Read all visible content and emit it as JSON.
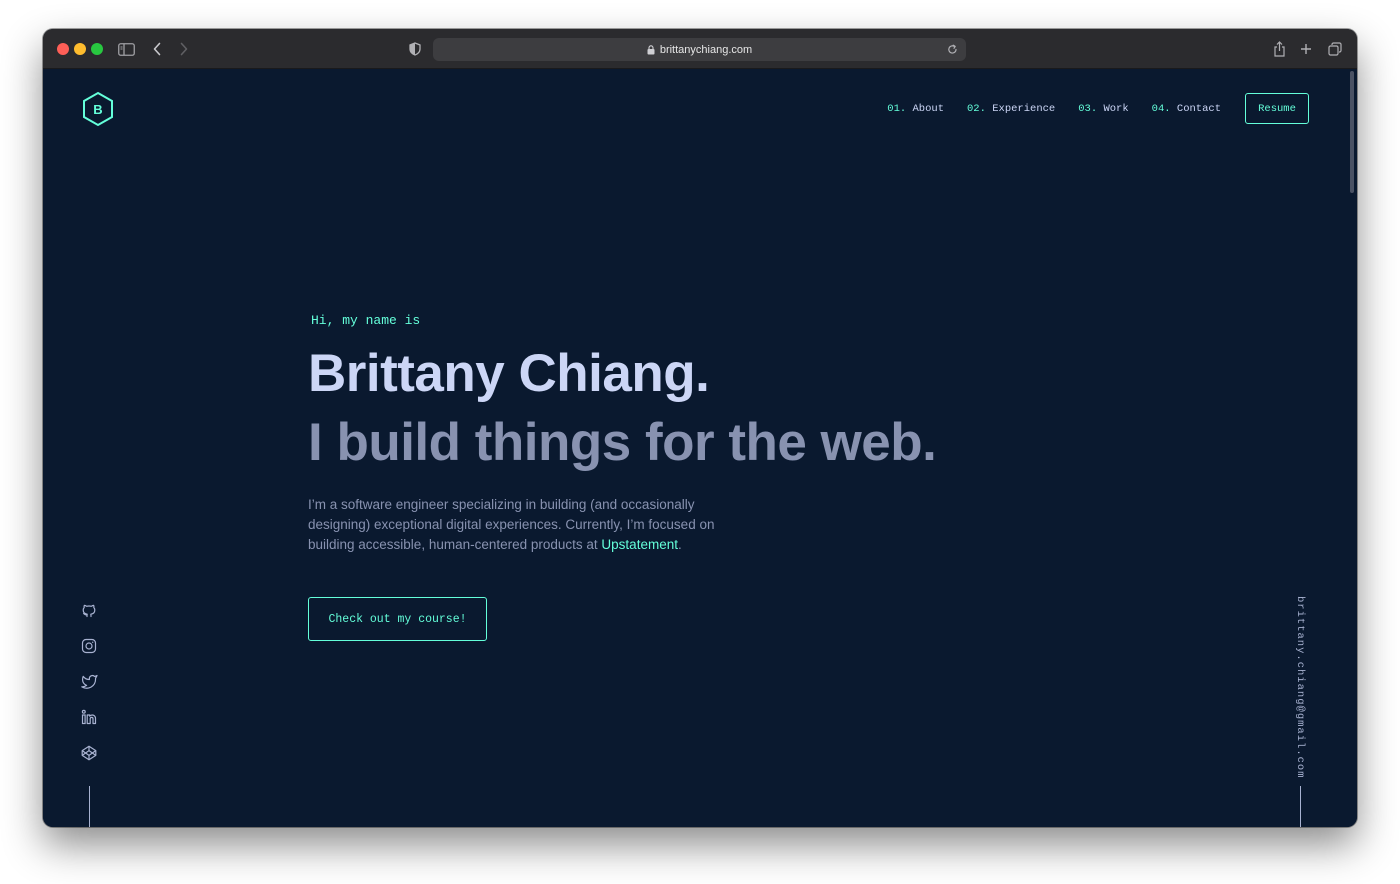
{
  "browser": {
    "url": "brittanychiang.com",
    "icons": [
      "sidebar-icon",
      "back-chevron-icon",
      "forward-chevron-icon",
      "shield-icon",
      "lock-icon",
      "reload-icon",
      "share-icon",
      "plus-icon",
      "tabs-icon"
    ]
  },
  "header": {
    "logo_letter": "B",
    "nav": [
      {
        "num": "01.",
        "label": "About"
      },
      {
        "num": "02.",
        "label": "Experience"
      },
      {
        "num": "03.",
        "label": "Work"
      },
      {
        "num": "04.",
        "label": "Contact"
      }
    ],
    "resume_label": "Resume"
  },
  "hero": {
    "greeting": "Hi, my name is",
    "name": "Brittany Chiang.",
    "tagline": "I build things for the web.",
    "bio_text": "I’m a software engineer specializing in building (and occasionally designing) exceptional digital experiences. Currently, I’m focused on building accessible, human-centered products at ",
    "bio_link": "Upstatement",
    "bio_end": ".",
    "cta_label": "Check out my course!"
  },
  "socials": [
    "github-icon",
    "instagram-icon",
    "twitter-icon",
    "linkedin-icon",
    "codepen-icon"
  ],
  "email": "brittany.chiang@gmail.com",
  "colors": {
    "background": "#0a192f",
    "accent": "#64ffda",
    "heading": "#ccd6f6",
    "body": "#8892b0"
  }
}
